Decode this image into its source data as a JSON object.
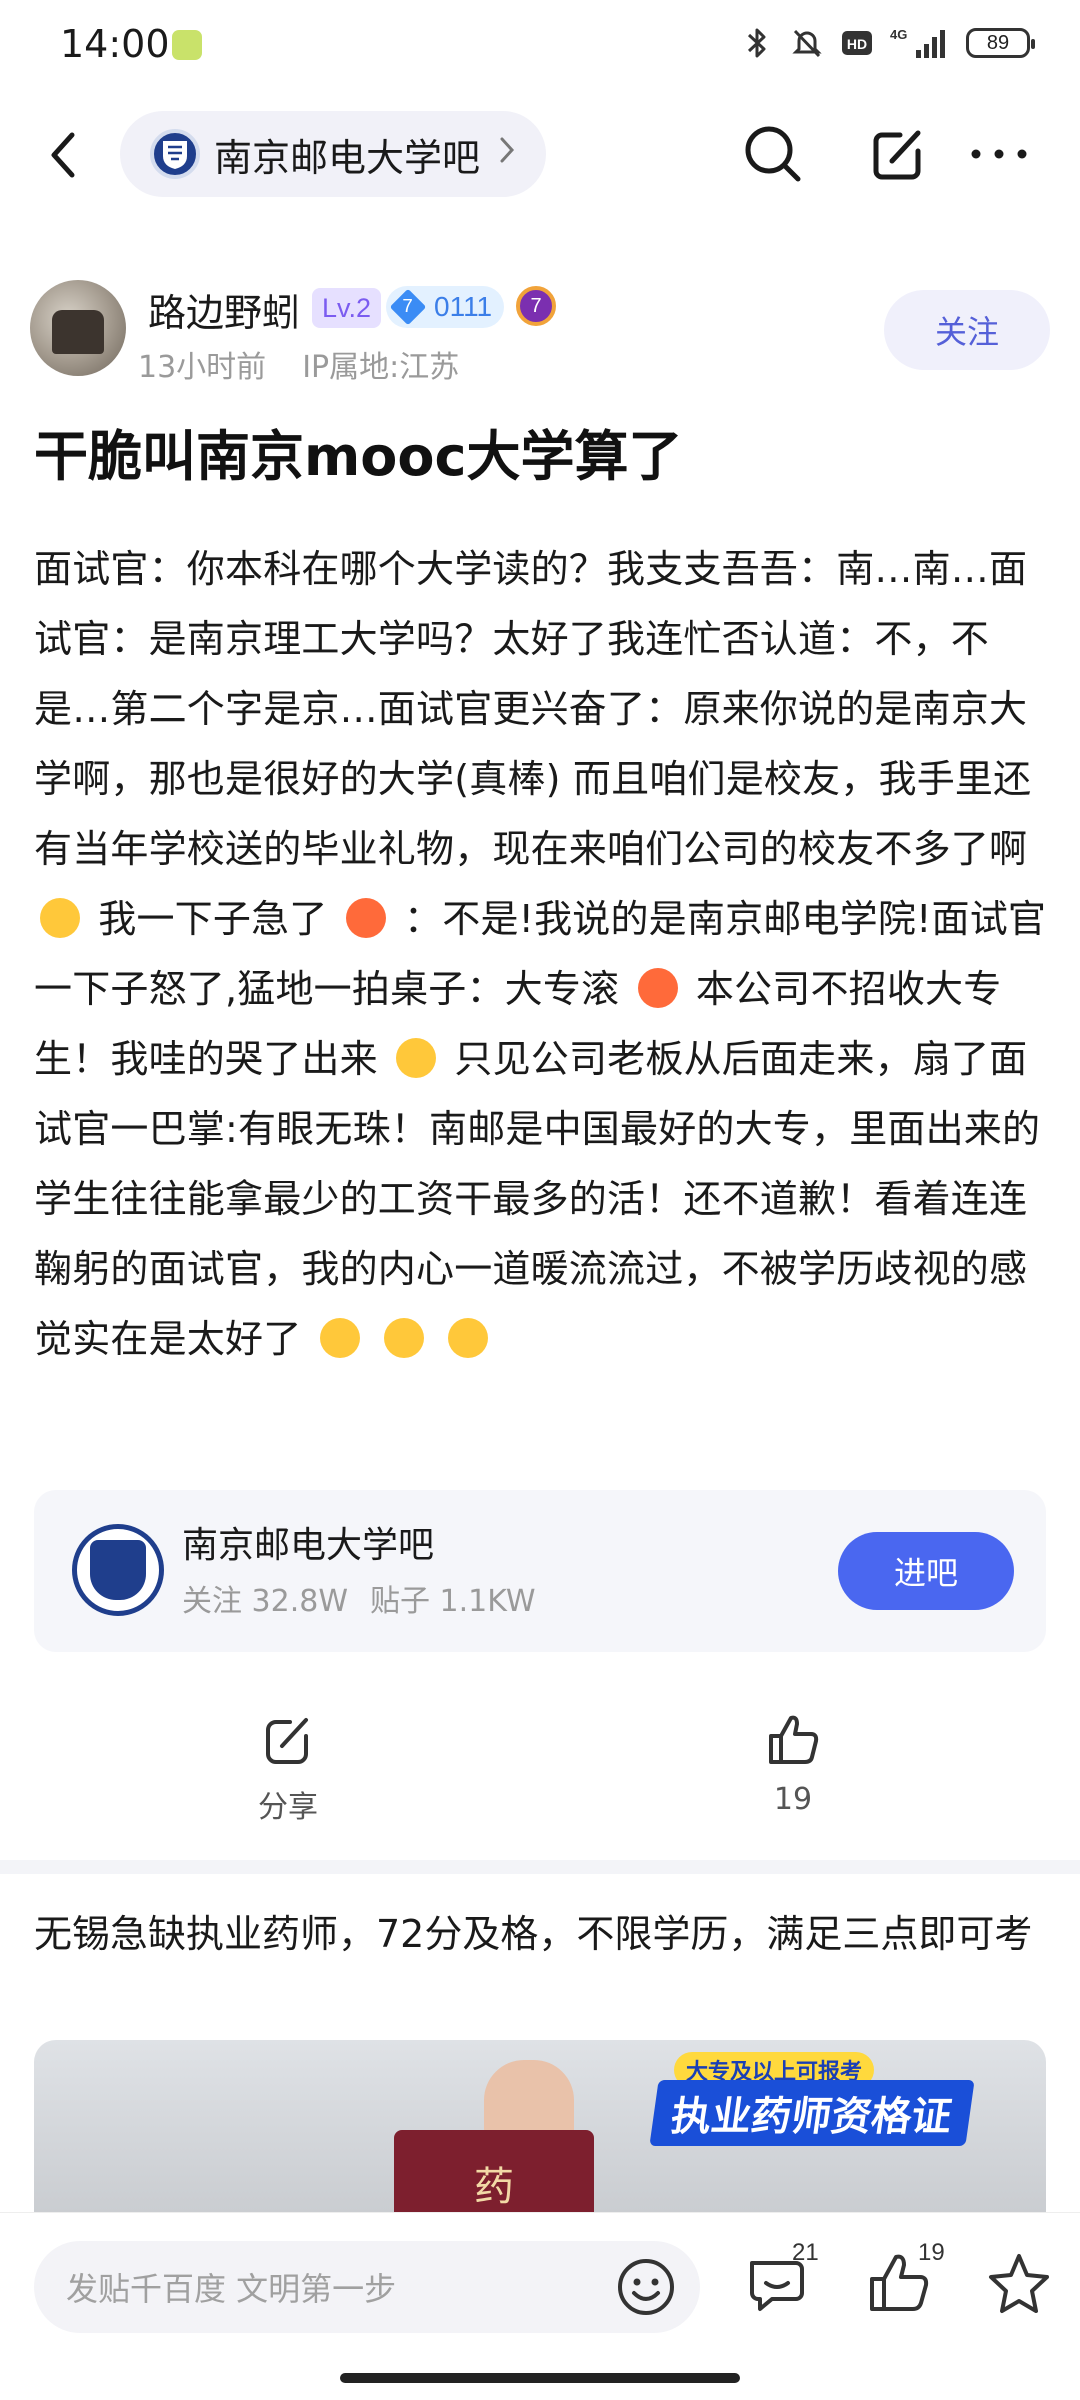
{
  "status_bar": {
    "time": "14:00",
    "battery": "89",
    "icons": [
      "app-notification-icon",
      "bluetooth-icon",
      "mute-icon",
      "hd-icon",
      "4g-signal-icon",
      "battery-icon"
    ]
  },
  "nav": {
    "forum_name": "南京邮电大学吧",
    "icons": [
      "back-arrow-icon",
      "search-icon",
      "edit-share-icon",
      "more-icon"
    ]
  },
  "author": {
    "name": "路边野蚓",
    "level": "Lv.2",
    "gem_level": "7",
    "gem_id": "0111",
    "medal_level": "7",
    "time_ago": "13小时前",
    "ip_location": "IP属地:江苏",
    "follow_label": "关注"
  },
  "post": {
    "title": "干脆叫南京mooc大学算了",
    "body_segments": [
      "面试官：你本科在哪个大学读的？我支支吾吾：南…南…面试官：是南京理工大学吗？太好了我连忙否认道：不，不是…第二个字是京…面试官更兴奋了：原来你说的是南京大学啊，那也是很好的大学(真棒) 而且咱们是校友，我手里还有当年学校送的毕业礼物，现在来咱们公司的校友不多了啊",
      "我一下子急了",
      "：不是!我说的是南京邮电学院!面试官一下子怒了,猛地一拍桌子：大专滚",
      "本公司不招收大专生！我哇的哭了出来",
      "只见公司老板从后面走来，扇了面试官一巴掌:有眼无珠！南邮是中国最好的大专，里面出来的学生往往能拿最少的工资干最多的活！还不道歉！看着连连鞠躬的面试官，我的内心一道暖流流过，不被学历歧视的感觉实在是太好了"
    ],
    "emojis": [
      "grin-emoji",
      "angry-emoji",
      "rage-emoji",
      "crying-emoji",
      "crying-emoji",
      "crying-emoji",
      "crying-emoji"
    ]
  },
  "forum_card": {
    "name": "南京邮电大学吧",
    "followers": "关注 32.8W",
    "posts": "贴子 1.1KW",
    "enter_label": "进吧"
  },
  "actions": {
    "share_label": "分享",
    "like_count": "19"
  },
  "next_post": {
    "title": "无锡急缺执业药师，72分及格，不限学历，满足三点即可考",
    "image_banner": "执业药师资格证",
    "image_banner_small": "大专及以上可报考",
    "image_book_text": "药"
  },
  "bottom_bar": {
    "reply_placeholder": "发贴千百度 文明第一步",
    "comment_count": "21",
    "like_count": "19"
  },
  "colors": {
    "accent_blue": "#4a67f0",
    "follow_text": "#5560d8",
    "meta_gray": "#9a9a9a"
  }
}
